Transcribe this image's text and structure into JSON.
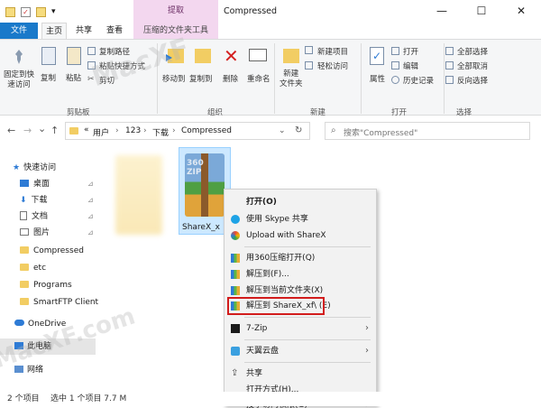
{
  "window": {
    "title": "Compressed",
    "context_tab_header": "提取",
    "minimize_glyph": "—",
    "maximize_glyph": "☐",
    "close_glyph": "✕"
  },
  "qat": {
    "dropdown_glyph": "▾"
  },
  "tabs": {
    "file": "文件",
    "home": "主页",
    "share": "共享",
    "view": "查看",
    "compressed_tools": "压缩的文件夹工具"
  },
  "ribbon": {
    "clipboard": {
      "pin_quick_access": "固定到快\n速访问",
      "copy": "复制",
      "paste": "粘贴",
      "copy_path": "复制路径",
      "paste_shortcut": "粘贴快捷方式",
      "cut": "剪切",
      "group": "剪贴板"
    },
    "organize": {
      "move_to": "移动到",
      "copy_to": "复制到",
      "delete": "删除",
      "rename": "重命名",
      "group": "组织"
    },
    "new": {
      "new_folder": "新建\n文件夹",
      "new_item": "新建项目",
      "easy_access": "轻松访问",
      "group": "新建"
    },
    "open": {
      "properties": "属性",
      "open": "打开",
      "edit": "编辑",
      "history": "历史记录",
      "group": "打开"
    },
    "select": {
      "select_all": "全部选择",
      "select_none": "全部取消",
      "invert": "反向选择",
      "group": "选择"
    }
  },
  "address": {
    "back": "←",
    "forward": "→",
    "dropdown": "⌄",
    "up": "↑",
    "path_prefix": "«",
    "path": [
      "用户",
      "123",
      "下载",
      "Compressed"
    ],
    "separator": "›",
    "refresh": "↻",
    "search_placeholder": "搜索\"Compressed\""
  },
  "nav": {
    "items": [
      {
        "label": "快速访问",
        "pinned": false
      },
      {
        "label": "桌面",
        "pinned": true
      },
      {
        "label": "下载",
        "pinned": true
      },
      {
        "label": "文档",
        "pinned": true
      },
      {
        "label": "图片",
        "pinned": true
      },
      {
        "label": "Compressed",
        "pinned": false
      },
      {
        "label": "etc",
        "pinned": false
      },
      {
        "label": "Programs",
        "pinned": false
      },
      {
        "label": "SmartFTP Client",
        "pinned": false
      },
      {
        "label": "OneDrive",
        "pinned": false
      },
      {
        "label": "此电脑",
        "pinned": false
      },
      {
        "label": "网络",
        "pinned": false
      }
    ],
    "pin_glyph": "📌"
  },
  "files": [
    {
      "label": "",
      "selected": false
    },
    {
      "label": "ShareX_x",
      "selected": true
    }
  ],
  "zip_icon_text": "360\nZIP",
  "context_menu": {
    "items": [
      {
        "label": "打开(O)",
        "bold": true
      },
      {
        "label": "使用 Skype 共享"
      },
      {
        "label": "Upload with ShareX"
      },
      {
        "label": "用360压缩打开(Q)"
      },
      {
        "label": "解压到(F)..."
      },
      {
        "label": "解压到当前文件夹(X)"
      },
      {
        "label": "解压到 ShareX_xf\\ (E)",
        "highlighted": true
      },
      {
        "label": "7-Zip",
        "submenu": true
      },
      {
        "label": "天翼云盘",
        "submenu": true
      },
      {
        "label": "共享"
      },
      {
        "label": "打开方式(H)..."
      },
      {
        "label": "授予访问权限(G)",
        "submenu": true
      }
    ],
    "submenu_arrow": "›",
    "highlight_color": "#d21c1c"
  },
  "status": {
    "count": "2 个项目",
    "selected": "选中 1 个项目 7.7 M"
  },
  "watermark": {
    "text1": "MacXF",
    "text2": "MacXF.com"
  }
}
